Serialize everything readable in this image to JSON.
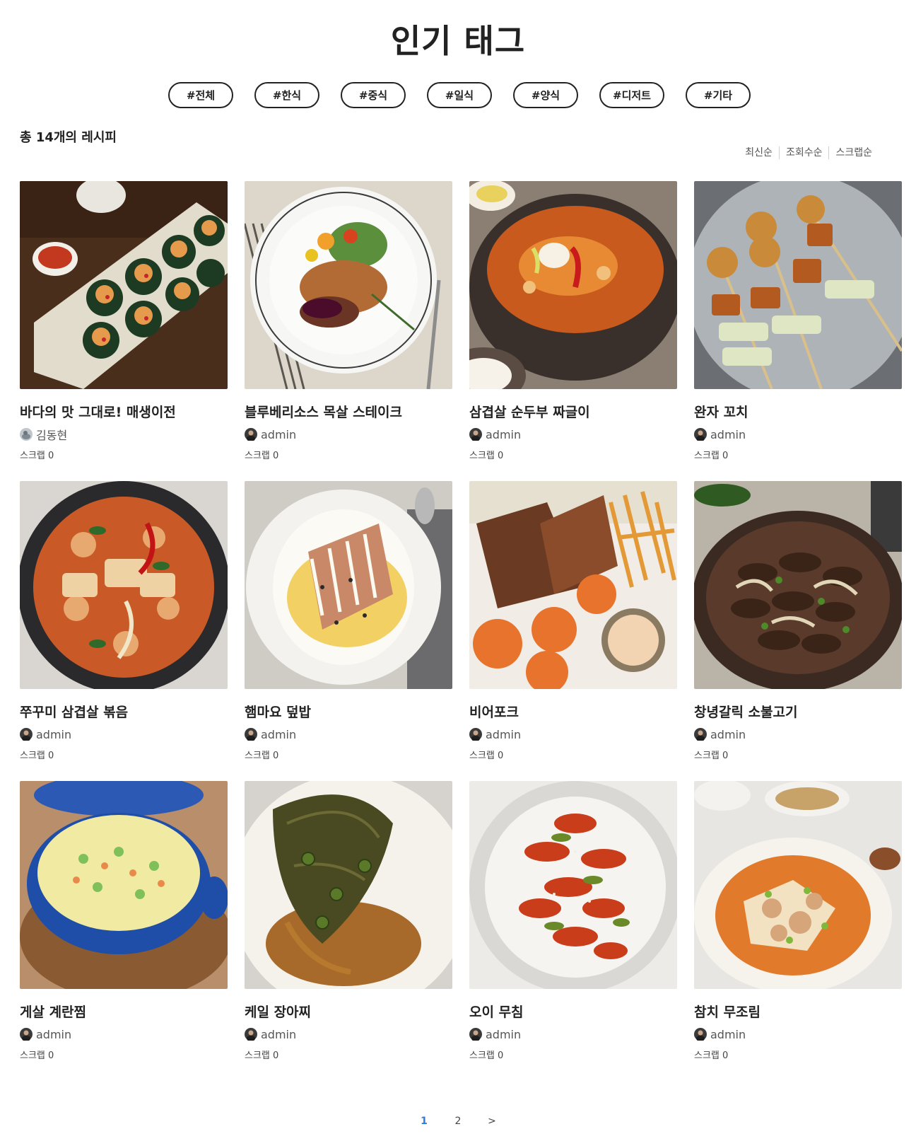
{
  "header": {
    "title": "인기 태그"
  },
  "tags": [
    "#전체",
    "#한식",
    "#중식",
    "#일식",
    "#양식",
    "#디저트",
    "#기타"
  ],
  "total_text": "총 14개의 레시피",
  "sort": [
    "최신순",
    "조회수순",
    "스크랩순"
  ],
  "cards": [
    {
      "title": "바다의 맛 그대로! 매생이전",
      "author": "김동현",
      "scrap": "스크랩 0",
      "image": "seaweed-shrimp-pancakes-photo"
    },
    {
      "title": "블루베리소스 목살 스테이크",
      "author": "admin",
      "scrap": "스크랩 0",
      "image": "pork-steak-blueberry-sauce-photo"
    },
    {
      "title": "삼겹살 순두부 짜글이",
      "author": "admin",
      "scrap": "스크랩 0",
      "image": "sundubu-stew-pot-photo"
    },
    {
      "title": "완자 꼬치",
      "author": "admin",
      "scrap": "스크랩 0",
      "image": "meatball-skewers-photo"
    },
    {
      "title": "쭈꾸미 삼겹살 볶음",
      "author": "admin",
      "scrap": "스크랩 0",
      "image": "webfoot-octopus-pork-stirfry-photo"
    },
    {
      "title": "햄마요 덮밥",
      "author": "admin",
      "scrap": "스크랩 0",
      "image": "ham-mayo-rice-bowl-photo"
    },
    {
      "title": "비어포크",
      "author": "admin",
      "scrap": "스크랩 0",
      "image": "beer-pork-fries-photo"
    },
    {
      "title": "창녕갈릭 소불고기",
      "author": "admin",
      "scrap": "스크랩 0",
      "image": "garlic-beef-bulgogi-photo"
    },
    {
      "title": "게살 계란찜",
      "author": "admin",
      "scrap": "스크랩 0",
      "image": "crab-steamed-egg-pot-photo"
    },
    {
      "title": "케일 장아찌",
      "author": "admin",
      "scrap": "스크랩 0",
      "image": "kale-pickles-photo"
    },
    {
      "title": "오이 무침",
      "author": "admin",
      "scrap": "스크랩 0",
      "image": "spicy-cucumber-salad-photo"
    },
    {
      "title": "참치 무조림",
      "author": "admin",
      "scrap": "스크랩 0",
      "image": "tuna-braised-radish-photo"
    }
  ],
  "pagination": {
    "pages": [
      "1",
      "2"
    ],
    "current": "1",
    "next": ">"
  },
  "colors": {
    "accent": "#2e7de0",
    "text": "#222222",
    "muted": "#555555"
  }
}
